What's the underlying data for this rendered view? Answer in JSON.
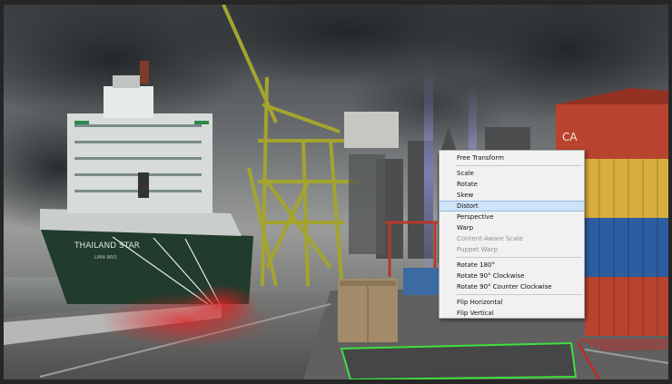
{
  "canvas": {
    "ship_name": "THAILAND STAR",
    "ship_subtitle": "LIMA BRO",
    "container_mark": "CA"
  },
  "context_menu": {
    "groups": [
      [
        {
          "label": "Free Transform",
          "enabled": true
        }
      ],
      [
        {
          "label": "Scale",
          "enabled": true
        },
        {
          "label": "Rotate",
          "enabled": true
        },
        {
          "label": "Skew",
          "enabled": true
        },
        {
          "label": "Distort",
          "enabled": true,
          "selected": true
        },
        {
          "label": "Perspective",
          "enabled": true
        },
        {
          "label": "Warp",
          "enabled": true
        },
        {
          "label": "Content-Aware Scale",
          "enabled": false
        },
        {
          "label": "Puppet Warp",
          "enabled": false
        }
      ],
      [
        {
          "label": "Rotate 180°",
          "enabled": true
        },
        {
          "label": "Rotate 90° Clockwise",
          "enabled": true
        },
        {
          "label": "Rotate 90° Counter Clockwise",
          "enabled": true
        }
      ],
      [
        {
          "label": "Flip Horizontal",
          "enabled": true
        },
        {
          "label": "Flip Vertical",
          "enabled": true
        }
      ]
    ]
  },
  "colors": {
    "selection_box": "#3ee03e",
    "selection_highlight": "#cfe3f7",
    "mask_overlay": "#e02020"
  }
}
